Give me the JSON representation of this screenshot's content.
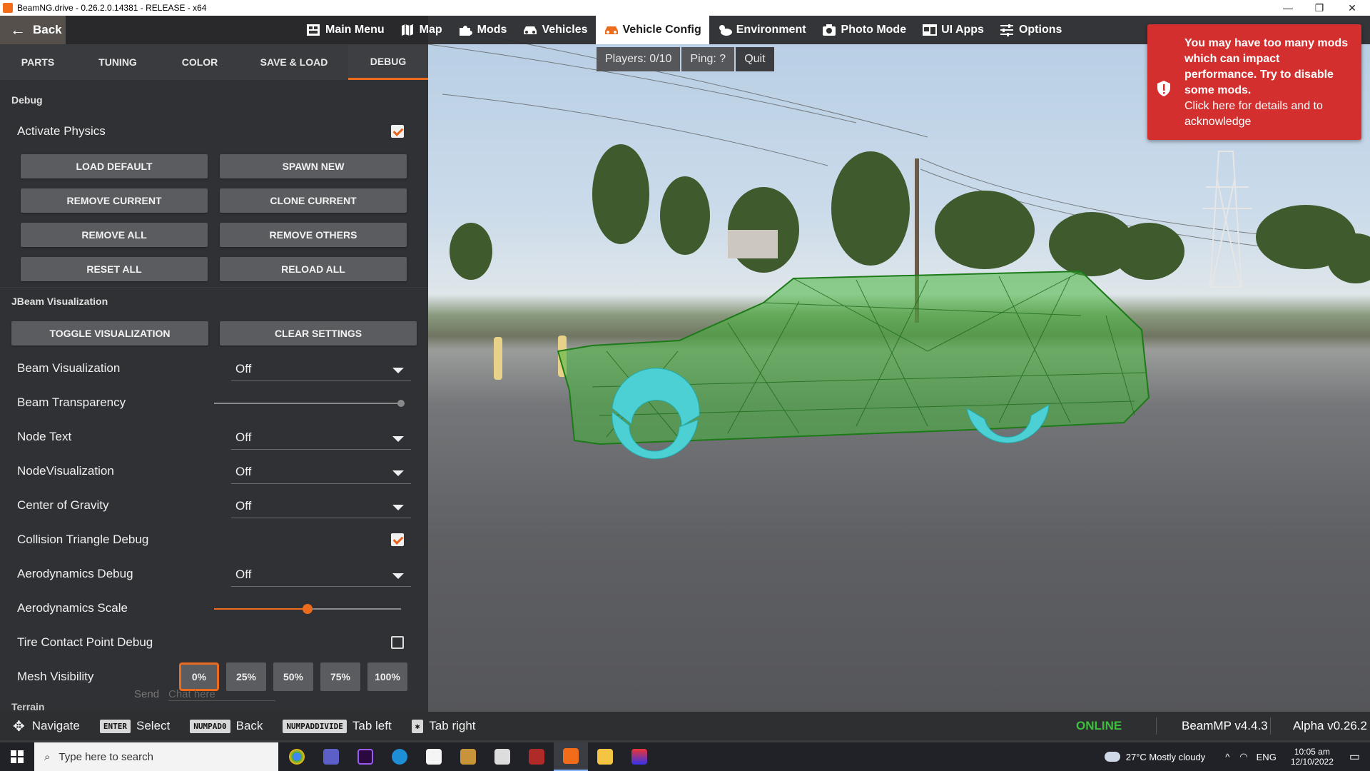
{
  "window": {
    "title": "BeamNG.drive - 0.26.2.0.14381 - RELEASE - x64",
    "controls": [
      "—",
      "❐",
      "✕"
    ]
  },
  "topmenu": {
    "back_label": "Back",
    "items": [
      {
        "label": "Main Menu",
        "icon": "main-menu-icon"
      },
      {
        "label": "Map",
        "icon": "map-icon"
      },
      {
        "label": "Mods",
        "icon": "puzzle-icon"
      },
      {
        "label": "Vehicles",
        "icon": "car-icon"
      },
      {
        "label": "Vehicle Config",
        "icon": "car-config-icon",
        "active": true
      },
      {
        "label": "Environment",
        "icon": "weather-icon"
      },
      {
        "label": "Photo Mode",
        "icon": "camera-icon"
      },
      {
        "label": "UI Apps",
        "icon": "ui-apps-icon"
      },
      {
        "label": "Options",
        "icon": "sliders-icon"
      }
    ],
    "accent": "#ec6b1c"
  },
  "tabs": [
    "PARTS",
    "TUNING",
    "COLOR",
    "SAVE & LOAD",
    "DEBUG"
  ],
  "debug": {
    "section_title": "Debug",
    "activate_physics": "Activate Physics",
    "buttons": [
      "LOAD DEFAULT",
      "SPAWN NEW",
      "REMOVE CURRENT",
      "CLONE CURRENT",
      "REMOVE ALL",
      "REMOVE OTHERS",
      "RESET ALL",
      "RELOAD ALL"
    ]
  },
  "jbeam": {
    "section_title": "JBeam Visualization",
    "toggle_label": "TOGGLE VISUALIZATION",
    "clear_label": "CLEAR SETTINGS",
    "beam_visualization": {
      "label": "Beam Visualization",
      "value": "Off"
    },
    "beam_transparency": {
      "label": "Beam Transparency",
      "value": 1.0
    },
    "node_text": {
      "label": "Node Text",
      "value": "Off"
    },
    "node_visualization": {
      "label": "NodeVisualization",
      "value": "Off"
    },
    "center_of_gravity": {
      "label": "Center of Gravity",
      "value": "Off"
    },
    "collision_triangle": {
      "label": "Collision Triangle Debug",
      "checked": true
    },
    "aero_debug": {
      "label": "Aerodynamics Debug",
      "value": "Off"
    },
    "aero_scale": {
      "label": "Aerodynamics Scale",
      "value": 0.5
    },
    "tire_contact": {
      "label": "Tire Contact Point Debug",
      "checked": false
    },
    "mesh_visibility": {
      "label": "Mesh Visibility",
      "options": [
        "0%",
        "25%",
        "50%",
        "75%",
        "100%"
      ],
      "selected": "0%"
    },
    "terrain_label": "Terrain"
  },
  "chat": {
    "send": "Send",
    "placeholder": "Chat here"
  },
  "multiplayer": {
    "players": "Players: 0/10",
    "ping": "Ping: ?",
    "quit": "Quit"
  },
  "notification": {
    "bold": "You may have too many mods which can impact performance. Try to disable some mods.",
    "detail": "Click here for details and to acknowledge",
    "color": "#d32f2f"
  },
  "helpbar": {
    "navigate": "Navigate",
    "enter_key": "ENTER",
    "select": "Select",
    "numpad0_key": "NUMPAD0",
    "back": "Back",
    "numpaddivide_key": "NUMPADDIVIDE",
    "tab_left": "Tab left",
    "tab_right": "Tab right",
    "online": "ONLINE",
    "beammp": "BeamMP v4.4.3",
    "alpha": "Alpha v0.26.2"
  },
  "taskbar": {
    "search_placeholder": "Type here to search",
    "weather": "27°C  Mostly cloudy",
    "lang": "ENG",
    "time": "10:05 am",
    "date": "12/10/2022"
  }
}
